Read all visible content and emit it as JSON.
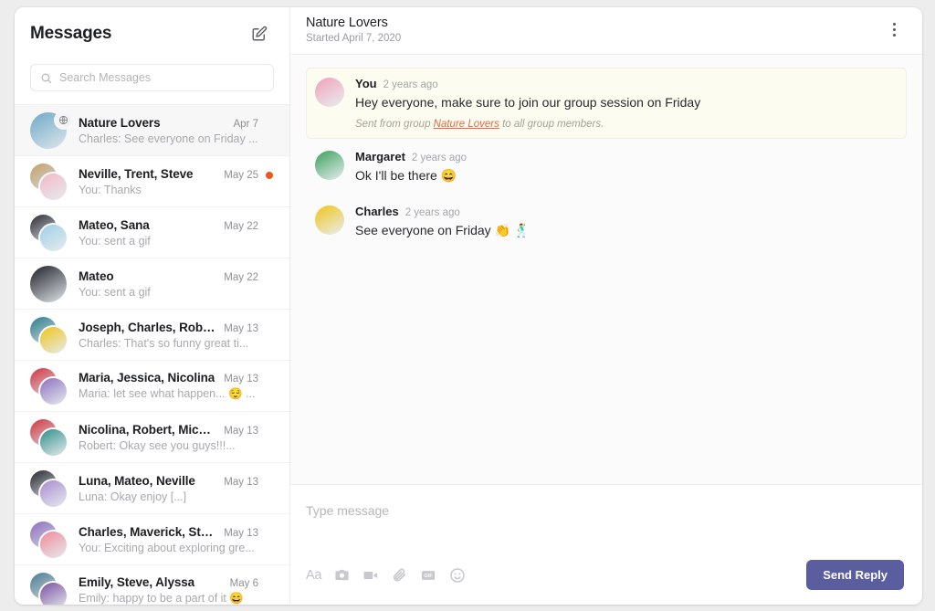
{
  "colors": {
    "accent_purple": "#5b5e9e",
    "unread_dot": "#f2541b",
    "link_orange": "#e06a3f",
    "highlight_bubble": "#fdfcf0",
    "page_background": "#ededed"
  },
  "sidebar": {
    "title": "Messages",
    "compose_icon": "compose-edit-icon",
    "search": {
      "placeholder": "Search Messages",
      "value": "",
      "icon": "search-icon"
    },
    "conversations": [
      {
        "name": "Nature Lovers",
        "preview": "Charles: See everyone on Friday ...",
        "date": "Apr 7",
        "selected": true,
        "unread": false,
        "is_group_badge": true,
        "avatar_type": "single",
        "avatar_colors": [
          "#6fa8c8"
        ]
      },
      {
        "name": "Neville, Trent, Steve",
        "preview": "You: Thanks",
        "date": "May 25",
        "selected": false,
        "unread": true,
        "is_group_badge": false,
        "avatar_type": "stack",
        "avatar_colors": [
          "#c8a16a",
          "#f4b8c8"
        ]
      },
      {
        "name": "Mateo, Sana",
        "preview": "You: sent a gif",
        "date": "May 22",
        "selected": false,
        "unread": false,
        "is_group_badge": false,
        "avatar_type": "stack",
        "avatar_colors": [
          "#2b2b33",
          "#9fd0e8"
        ]
      },
      {
        "name": "Mateo",
        "preview": "You: sent a gif",
        "date": "May 22",
        "selected": false,
        "unread": false,
        "is_group_badge": false,
        "avatar_type": "single",
        "avatar_colors": [
          "#1e1e26"
        ]
      },
      {
        "name": "Joseph, Charles, Robert",
        "preview": "Charles: That's so funny great ti...",
        "date": "May 13",
        "selected": false,
        "unread": false,
        "is_group_badge": false,
        "avatar_type": "stack",
        "avatar_colors": [
          "#2a7f8e",
          "#f0c419"
        ]
      },
      {
        "name": "Maria, Jessica, Nicolina",
        "preview": "Maria: let see what happen... 😌 ...",
        "date": "May 13",
        "selected": false,
        "unread": false,
        "is_group_badge": false,
        "avatar_type": "stack",
        "avatar_colors": [
          "#d8343f",
          "#8e6fc0"
        ]
      },
      {
        "name": "Nicolina, Robert, Michael",
        "preview": "Robert: Okay see you guys!!!...",
        "date": "May 13",
        "selected": false,
        "unread": false,
        "is_group_badge": false,
        "avatar_type": "stack",
        "avatar_colors": [
          "#d8343f",
          "#2f8f8a"
        ]
      },
      {
        "name": "Luna, Mateo, Neville",
        "preview": "Luna: Okay enjoy [...]",
        "date": "May 13",
        "selected": false,
        "unread": false,
        "is_group_badge": false,
        "avatar_type": "stack",
        "avatar_colors": [
          "#24242c",
          "#a98bd0"
        ]
      },
      {
        "name": "Charles, Maverick, Steve",
        "preview": "You: Exciting about exploring gre...",
        "date": "May 13",
        "selected": false,
        "unread": false,
        "is_group_badge": false,
        "avatar_type": "stack",
        "avatar_colors": [
          "#8e6fc0",
          "#f08a9a"
        ]
      },
      {
        "name": "Emily, Steve, Alyssa",
        "preview": "Emily: happy to be a part of it 😄",
        "date": "May 6",
        "selected": false,
        "unread": false,
        "is_group_badge": false,
        "avatar_type": "stack",
        "avatar_colors": [
          "#4a7b92",
          "#7b4fa0"
        ]
      }
    ]
  },
  "conversation": {
    "title": "Nature Lovers",
    "started": "Started April 7, 2020",
    "menu_icon": "kebab-menu-icon",
    "messages": [
      {
        "author": "You",
        "time": "2 years ago",
        "text": "Hey everyone, make sure to join our group session on Friday",
        "emoji": "",
        "highlight": true,
        "meta_prefix": "Sent from group ",
        "meta_link": "Nature Lovers",
        "meta_suffix": " to all group members.",
        "avatar_color": "#f2a0b8"
      },
      {
        "author": "Margaret",
        "time": "2 years ago",
        "text": "Ok I'll be there ",
        "emoji": "😄",
        "highlight": false,
        "avatar_color": "#3aa05a"
      },
      {
        "author": "Charles",
        "time": "2 years ago",
        "text": "See everyone on Friday ",
        "emoji": "👏 🕺",
        "highlight": false,
        "avatar_color": "#f0c419"
      }
    ]
  },
  "composer": {
    "placeholder": "Type message",
    "value": "",
    "send_label": "Send Reply",
    "tools": [
      {
        "name": "text-format-icon",
        "label": "Aa"
      },
      {
        "name": "camera-icon",
        "label": ""
      },
      {
        "name": "video-camera-icon",
        "label": ""
      },
      {
        "name": "attachment-icon",
        "label": ""
      },
      {
        "name": "gif-icon",
        "label": "GIF"
      },
      {
        "name": "emoji-icon",
        "label": ""
      }
    ]
  }
}
